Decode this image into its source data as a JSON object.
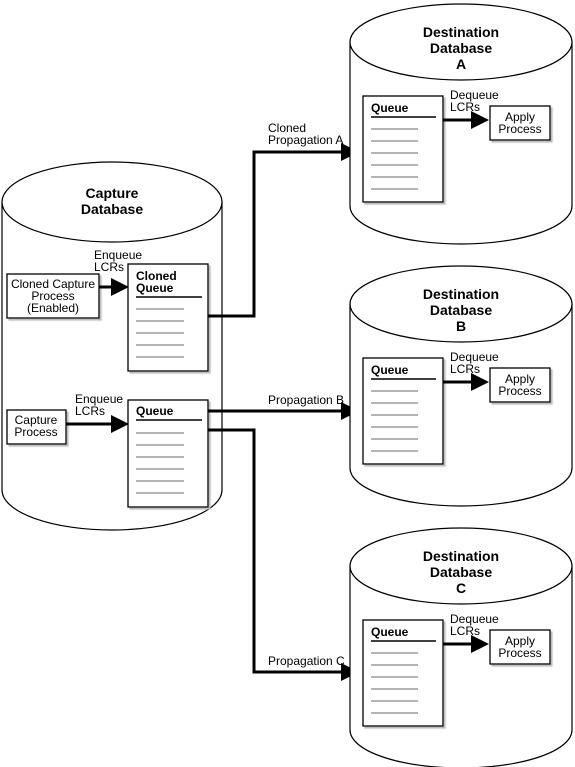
{
  "capture_db": {
    "title_lines": [
      "Capture",
      "Database"
    ],
    "cloned_capture": {
      "lines": [
        "Cloned Capture",
        "Process",
        "(Enabled)"
      ],
      "status": "Enabled"
    },
    "cloned_enqueue": [
      "Enqueue",
      "LCRs"
    ],
    "cloned_queue": [
      "Cloned",
      "Queue"
    ],
    "capture_process": [
      "Capture",
      "Process"
    ],
    "enqueue": [
      "Enqueue",
      "LCRs"
    ],
    "queue": "Queue"
  },
  "propagations": [
    {
      "lines": [
        "Cloned",
        "Propagation A"
      ]
    },
    {
      "lines": [
        "Propagation B"
      ]
    },
    {
      "lines": [
        "Propagation C"
      ]
    }
  ],
  "destinations": [
    {
      "title_lines": [
        "Destination",
        "Database",
        "A"
      ],
      "queue": "Queue",
      "dequeue": [
        "Dequeue",
        "LCRs"
      ],
      "apply": [
        "Apply",
        "Process"
      ]
    },
    {
      "title_lines": [
        "Destination",
        "Database",
        "B"
      ],
      "queue": "Queue",
      "dequeue": [
        "Dequeue",
        "LCRs"
      ],
      "apply": [
        "Apply",
        "Process"
      ]
    },
    {
      "title_lines": [
        "Destination",
        "Database",
        "C"
      ],
      "queue": "Queue",
      "dequeue": [
        "Dequeue",
        "LCRs"
      ],
      "apply": [
        "Apply",
        "Process"
      ]
    }
  ]
}
